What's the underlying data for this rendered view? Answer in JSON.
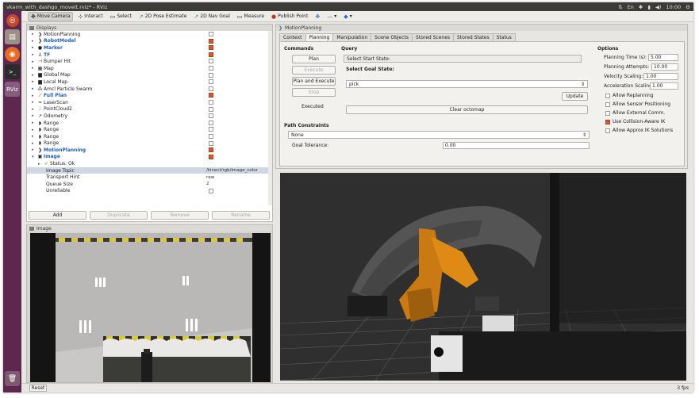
{
  "window": {
    "title": "vkarm_with_dashgo_moveit.rviz* - RViz",
    "clock": "10:00"
  },
  "topbar_tray": [
    "⇅",
    "En",
    "✱",
    "▮",
    "◀)"
  ],
  "launcher": [
    "ubuntu-logo-icon",
    "files-icon",
    "firefox-icon",
    "terminal-icon",
    "rviz-icon"
  ],
  "launcher_rviz_label": "RViz",
  "toolbar": [
    {
      "icon": "✥",
      "label": "Move Camera",
      "active": true
    },
    {
      "icon": "⊹",
      "label": "Interact",
      "active": false
    },
    {
      "icon": "▭",
      "label": "Select",
      "active": false
    },
    {
      "icon": "↗",
      "label": "2D Pose Estimate",
      "active": false
    },
    {
      "icon": "↗",
      "label": "2D Nav Goal",
      "active": false
    },
    {
      "icon": "",
      "label": "Measure",
      "active": false
    },
    {
      "icon": "●",
      "label": "Publish Point",
      "active": false
    },
    {
      "icon": "✥",
      "label": "",
      "active": false
    },
    {
      "icon": "—",
      "label": "",
      "active": false
    },
    {
      "icon": "◆",
      "label": "",
      "active": false
    }
  ],
  "displays": {
    "title": "Displays",
    "rows": [
      {
        "name": "MotionPlanning",
        "icon": "❯",
        "color": "",
        "checked": false,
        "blue": false,
        "arrow": "▸"
      },
      {
        "name": "RobotModel",
        "icon": "❯",
        "checked": true,
        "blue": true,
        "arrow": "▸"
      },
      {
        "name": "Marker",
        "icon": "●",
        "checked": true,
        "blue": true,
        "arrow": "▸"
      },
      {
        "name": "TF",
        "icon": "⅄",
        "checked": true,
        "blue": true,
        "arrow": "▸"
      },
      {
        "name": "Bumper Hit",
        "icon": "⊣",
        "checked": false,
        "blue": false,
        "arrow": "▸"
      },
      {
        "name": "Map",
        "icon": "▦",
        "checked": false,
        "blue": false,
        "arrow": "▸"
      },
      {
        "name": "Global Map",
        "icon": "▆",
        "checked": false,
        "blue": false,
        "arrow": "▸"
      },
      {
        "name": "Local Map",
        "icon": "▆",
        "checked": false,
        "blue": false,
        "arrow": "▸"
      },
      {
        "name": "Amcl Particle Swarm",
        "icon": "⁂",
        "checked": false,
        "blue": false,
        "arrow": "▸"
      },
      {
        "name": "Full Plan",
        "icon": "⟋",
        "checked": true,
        "blue": true,
        "arrow": "▸"
      },
      {
        "name": "LaserScan",
        "icon": "≈",
        "checked": false,
        "blue": false,
        "arrow": "▸"
      },
      {
        "name": "PointCloud2",
        "icon": "∴",
        "checked": false,
        "blue": false,
        "arrow": "▸"
      },
      {
        "name": "Odometry",
        "icon": "↗",
        "checked": false,
        "blue": false,
        "arrow": "▸"
      },
      {
        "name": "Range",
        "icon": "◗",
        "checked": false,
        "blue": false,
        "arrow": "▸"
      },
      {
        "name": "Range",
        "icon": "◗",
        "checked": false,
        "blue": false,
        "arrow": "▸"
      },
      {
        "name": "Range",
        "icon": "◗",
        "checked": false,
        "blue": false,
        "arrow": "▸"
      },
      {
        "name": "Range",
        "icon": "◗",
        "checked": false,
        "blue": false,
        "arrow": "▸"
      },
      {
        "name": "MotionPlanning",
        "icon": "❯",
        "checked": true,
        "blue": true,
        "arrow": "▸"
      },
      {
        "name": "Image",
        "icon": "▣",
        "checked": true,
        "blue": true,
        "arrow": "▾"
      }
    ],
    "status_ok": "Status: Ok",
    "props": [
      {
        "name": "Image Topic",
        "value": "/kinect/rgb/image_color"
      },
      {
        "name": "Transport Hint",
        "value": "raw"
      },
      {
        "name": "Queue Size",
        "value": "2"
      },
      {
        "name": "Unreliable",
        "value": ""
      }
    ],
    "buttons": [
      "Add",
      "Duplicate",
      "Remove",
      "Rename"
    ]
  },
  "image_panel": {
    "title": "Image"
  },
  "motion_planning": {
    "title": "MotionPlanning",
    "tabs": [
      "Context",
      "Planning",
      "Manipulation",
      "Scene Objects",
      "Stored Scenes",
      "Stored States",
      "Status"
    ],
    "active_tab": "Planning",
    "commands_header": "Commands",
    "btn_plan": "Plan",
    "btn_execute": "Execute",
    "btn_plan_execute": "Plan and Execute",
    "btn_stop": "Stop",
    "executed_label": "Executed",
    "query_header": "Query",
    "start_state": "Select Start State:",
    "goal_state": "Select Goal State:",
    "goal_select": "pick",
    "btn_update": "Update",
    "btn_clear": "Clear octomap",
    "path_constraints_header": "Path Constraints",
    "path_constraints_value": "None",
    "goal_tolerance_label": "Goal Tolerance:",
    "goal_tolerance_value": "0.00",
    "options_header": "Options",
    "planning_time_label": "Planning Time (s):",
    "planning_time": "5.00",
    "planning_attempts_label": "Planning Attempts:",
    "planning_attempts": "10.00",
    "velocity_scaling_label": "Velocity Scaling:",
    "velocity_scaling": "1.00",
    "accel_scaling_label": "Acceleration Scaling:",
    "accel_scaling": "1.00",
    "options": [
      {
        "label": "Allow Replanning",
        "checked": false
      },
      {
        "label": "Allow Sensor Positioning",
        "checked": false
      },
      {
        "label": "Allow External Comm.",
        "checked": false
      },
      {
        "label": "Use Collision-Aware IK",
        "checked": true
      },
      {
        "label": "Allow Approx IK Solutions",
        "checked": false
      }
    ]
  },
  "statusbar": {
    "reset": "Reset",
    "fps": "3 fps"
  }
}
